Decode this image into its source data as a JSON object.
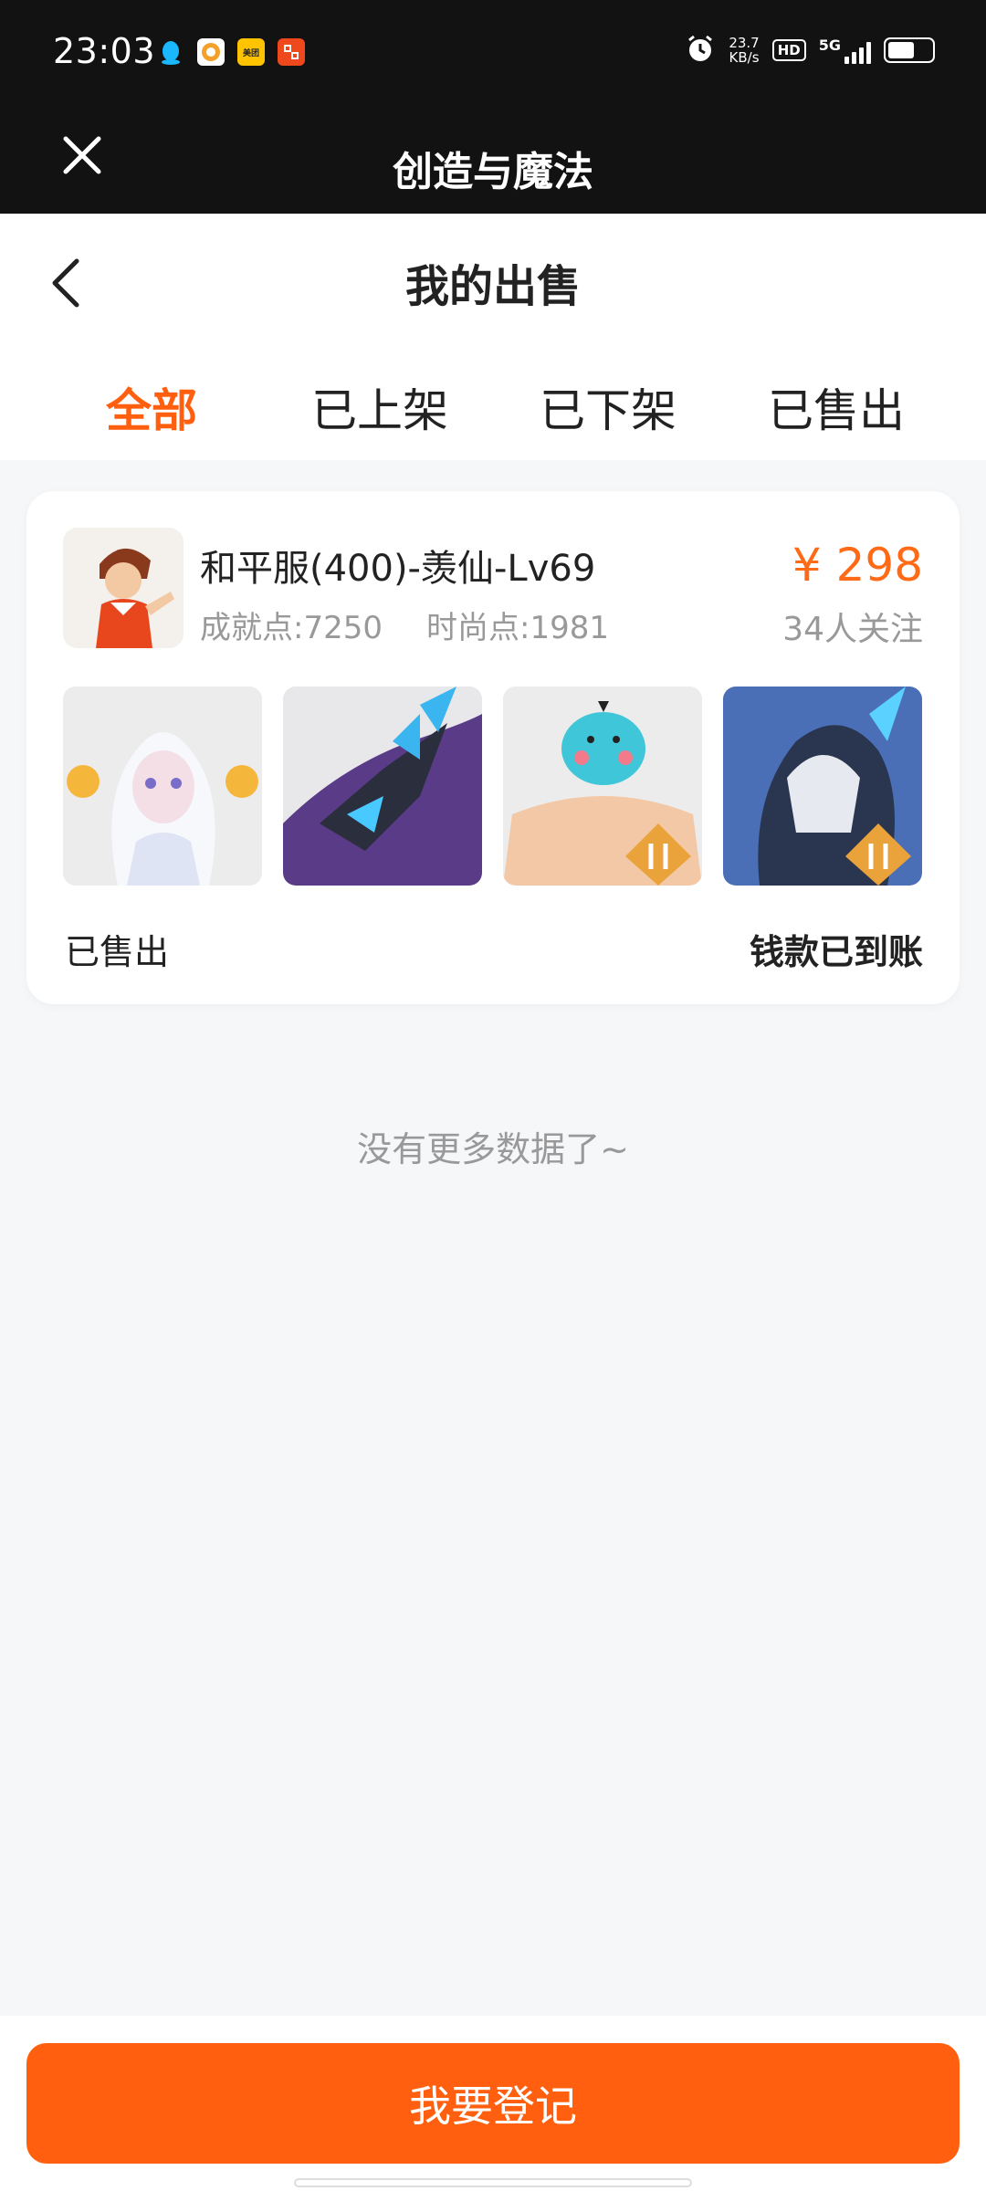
{
  "status_bar": {
    "time": "23:03",
    "net_speed_value": "23.7",
    "net_speed_unit": "KB/s",
    "hd_label": "HD",
    "network_label": "5G",
    "app_icons": [
      "qq-icon",
      "app-icon",
      "meituan-icon",
      "taobao-icon"
    ],
    "meituan_label": "美团"
  },
  "mini_program": {
    "title": "创造与魔法"
  },
  "nav": {
    "title": "我的出售"
  },
  "tabs": [
    {
      "label": "全部",
      "active": true
    },
    {
      "label": "已上架",
      "active": false
    },
    {
      "label": "已下架",
      "active": false
    },
    {
      "label": "已售出",
      "active": false
    }
  ],
  "item": {
    "title": "和平服(400)-羡仙-Lv69",
    "achievement": "成就点:7250",
    "fashion": "时尚点:1981",
    "price": "¥ 298",
    "followers": "34人关注",
    "status": "已售出",
    "payment_status": "钱款已到账",
    "thumbnails": [
      "white-haired-girl-image",
      "dark-dragon-image",
      "blue-bird-muscle-image",
      "armored-warrior-image"
    ]
  },
  "list_end": "没有更多数据了~",
  "bottom": {
    "register_label": "我要登记"
  },
  "colors": {
    "accent": "#ff5f0e",
    "price": "#ff6a17",
    "dark_header": "#121212",
    "background": "#f6f7f9"
  }
}
